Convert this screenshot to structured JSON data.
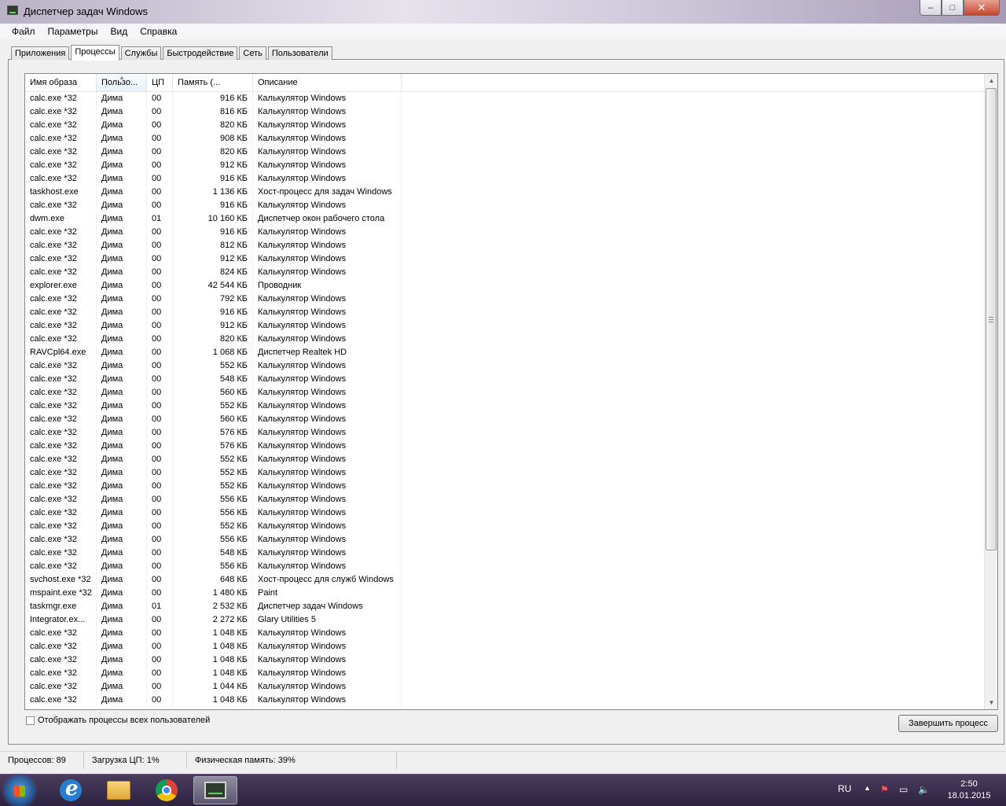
{
  "window": {
    "title": "Диспетчер задач Windows",
    "buttons": {
      "minimize": "–",
      "maximize": "□",
      "close": "✕"
    }
  },
  "menu": [
    "Файл",
    "Параметры",
    "Вид",
    "Справка"
  ],
  "tabs": [
    "Приложения",
    "Процессы",
    "Службы",
    "Быстродействие",
    "Сеть",
    "Пользователи"
  ],
  "active_tab": "Процессы",
  "columns": [
    "Имя образа",
    "Пользо...",
    "ЦП",
    "Память (...",
    "Описание"
  ],
  "processes": [
    [
      "calc.exe *32",
      "Дима",
      "00",
      "916 КБ",
      "Калькулятор Windows"
    ],
    [
      "calc.exe *32",
      "Дима",
      "00",
      "816 КБ",
      "Калькулятор Windows"
    ],
    [
      "calc.exe *32",
      "Дима",
      "00",
      "820 КБ",
      "Калькулятор Windows"
    ],
    [
      "calc.exe *32",
      "Дима",
      "00",
      "908 КБ",
      "Калькулятор Windows"
    ],
    [
      "calc.exe *32",
      "Дима",
      "00",
      "820 КБ",
      "Калькулятор Windows"
    ],
    [
      "calc.exe *32",
      "Дима",
      "00",
      "912 КБ",
      "Калькулятор Windows"
    ],
    [
      "calc.exe *32",
      "Дима",
      "00",
      "916 КБ",
      "Калькулятор Windows"
    ],
    [
      "taskhost.exe",
      "Дима",
      "00",
      "1 136 КБ",
      "Хост-процесс для задач Windows"
    ],
    [
      "calc.exe *32",
      "Дима",
      "00",
      "916 КБ",
      "Калькулятор Windows"
    ],
    [
      "dwm.exe",
      "Дима",
      "01",
      "10 160 КБ",
      "Диспетчер окон рабочего стола"
    ],
    [
      "calc.exe *32",
      "Дима",
      "00",
      "916 КБ",
      "Калькулятор Windows"
    ],
    [
      "calc.exe *32",
      "Дима",
      "00",
      "812 КБ",
      "Калькулятор Windows"
    ],
    [
      "calc.exe *32",
      "Дима",
      "00",
      "912 КБ",
      "Калькулятор Windows"
    ],
    [
      "calc.exe *32",
      "Дима",
      "00",
      "824 КБ",
      "Калькулятор Windows"
    ],
    [
      "explorer.exe",
      "Дима",
      "00",
      "42 544 КБ",
      "Проводник"
    ],
    [
      "calc.exe *32",
      "Дима",
      "00",
      "792 КБ",
      "Калькулятор Windows"
    ],
    [
      "calc.exe *32",
      "Дима",
      "00",
      "916 КБ",
      "Калькулятор Windows"
    ],
    [
      "calc.exe *32",
      "Дима",
      "00",
      "912 КБ",
      "Калькулятор Windows"
    ],
    [
      "calc.exe *32",
      "Дима",
      "00",
      "820 КБ",
      "Калькулятор Windows"
    ],
    [
      "RAVCpl64.exe",
      "Дима",
      "00",
      "1 068 КБ",
      "Диспетчер Realtek HD"
    ],
    [
      "calc.exe *32",
      "Дима",
      "00",
      "552 КБ",
      "Калькулятор Windows"
    ],
    [
      "calc.exe *32",
      "Дима",
      "00",
      "548 КБ",
      "Калькулятор Windows"
    ],
    [
      "calc.exe *32",
      "Дима",
      "00",
      "560 КБ",
      "Калькулятор Windows"
    ],
    [
      "calc.exe *32",
      "Дима",
      "00",
      "552 КБ",
      "Калькулятор Windows"
    ],
    [
      "calc.exe *32",
      "Дима",
      "00",
      "560 КБ",
      "Калькулятор Windows"
    ],
    [
      "calc.exe *32",
      "Дима",
      "00",
      "576 КБ",
      "Калькулятор Windows"
    ],
    [
      "calc.exe *32",
      "Дима",
      "00",
      "576 КБ",
      "Калькулятор Windows"
    ],
    [
      "calc.exe *32",
      "Дима",
      "00",
      "552 КБ",
      "Калькулятор Windows"
    ],
    [
      "calc.exe *32",
      "Дима",
      "00",
      "552 КБ",
      "Калькулятор Windows"
    ],
    [
      "calc.exe *32",
      "Дима",
      "00",
      "552 КБ",
      "Калькулятор Windows"
    ],
    [
      "calc.exe *32",
      "Дима",
      "00",
      "556 КБ",
      "Калькулятор Windows"
    ],
    [
      "calc.exe *32",
      "Дима",
      "00",
      "556 КБ",
      "Калькулятор Windows"
    ],
    [
      "calc.exe *32",
      "Дима",
      "00",
      "552 КБ",
      "Калькулятор Windows"
    ],
    [
      "calc.exe *32",
      "Дима",
      "00",
      "556 КБ",
      "Калькулятор Windows"
    ],
    [
      "calc.exe *32",
      "Дима",
      "00",
      "548 КБ",
      "Калькулятор Windows"
    ],
    [
      "calc.exe *32",
      "Дима",
      "00",
      "556 КБ",
      "Калькулятор Windows"
    ],
    [
      "svchost.exe *32",
      "Дима",
      "00",
      "648 КБ",
      "Хост-процесс для служб Windows"
    ],
    [
      "mspaint.exe *32",
      "Дима",
      "00",
      "1 480 КБ",
      "Paint"
    ],
    [
      "taskmgr.exe",
      "Дима",
      "01",
      "2 532 КБ",
      "Диспетчер задач Windows"
    ],
    [
      "Integrator.ex...",
      "Дима",
      "00",
      "2 272 КБ",
      "Glary Utilities 5"
    ],
    [
      "calc.exe *32",
      "Дима",
      "00",
      "1 048 КБ",
      "Калькулятор Windows"
    ],
    [
      "calc.exe *32",
      "Дима",
      "00",
      "1 048 КБ",
      "Калькулятор Windows"
    ],
    [
      "calc.exe *32",
      "Дима",
      "00",
      "1 048 КБ",
      "Калькулятор Windows"
    ],
    [
      "calc.exe *32",
      "Дима",
      "00",
      "1 048 КБ",
      "Калькулятор Windows"
    ],
    [
      "calc.exe *32",
      "Дима",
      "00",
      "1 044 КБ",
      "Калькулятор Windows"
    ],
    [
      "calc.exe *32",
      "Дима",
      "00",
      "1 048 КБ",
      "Калькулятор Windows"
    ]
  ],
  "show_all_label": "Отображать процессы всех пользователей",
  "end_process_label": "Завершить процесс",
  "status": {
    "processes": "Процессов: 89",
    "cpu": "Загрузка ЦП: 1%",
    "memory": "Физическая память: 39%"
  },
  "taskbar": {
    "lang": "RU",
    "time": "2:50",
    "date": "18.01.2015"
  },
  "icons": {
    "app": "task-manager-icon",
    "start": "windows-start-orb",
    "ie": "internet-explorer-icon",
    "explorer": "folder-icon",
    "chrome": "chrome-icon",
    "taskmgr": "task-manager-icon"
  }
}
